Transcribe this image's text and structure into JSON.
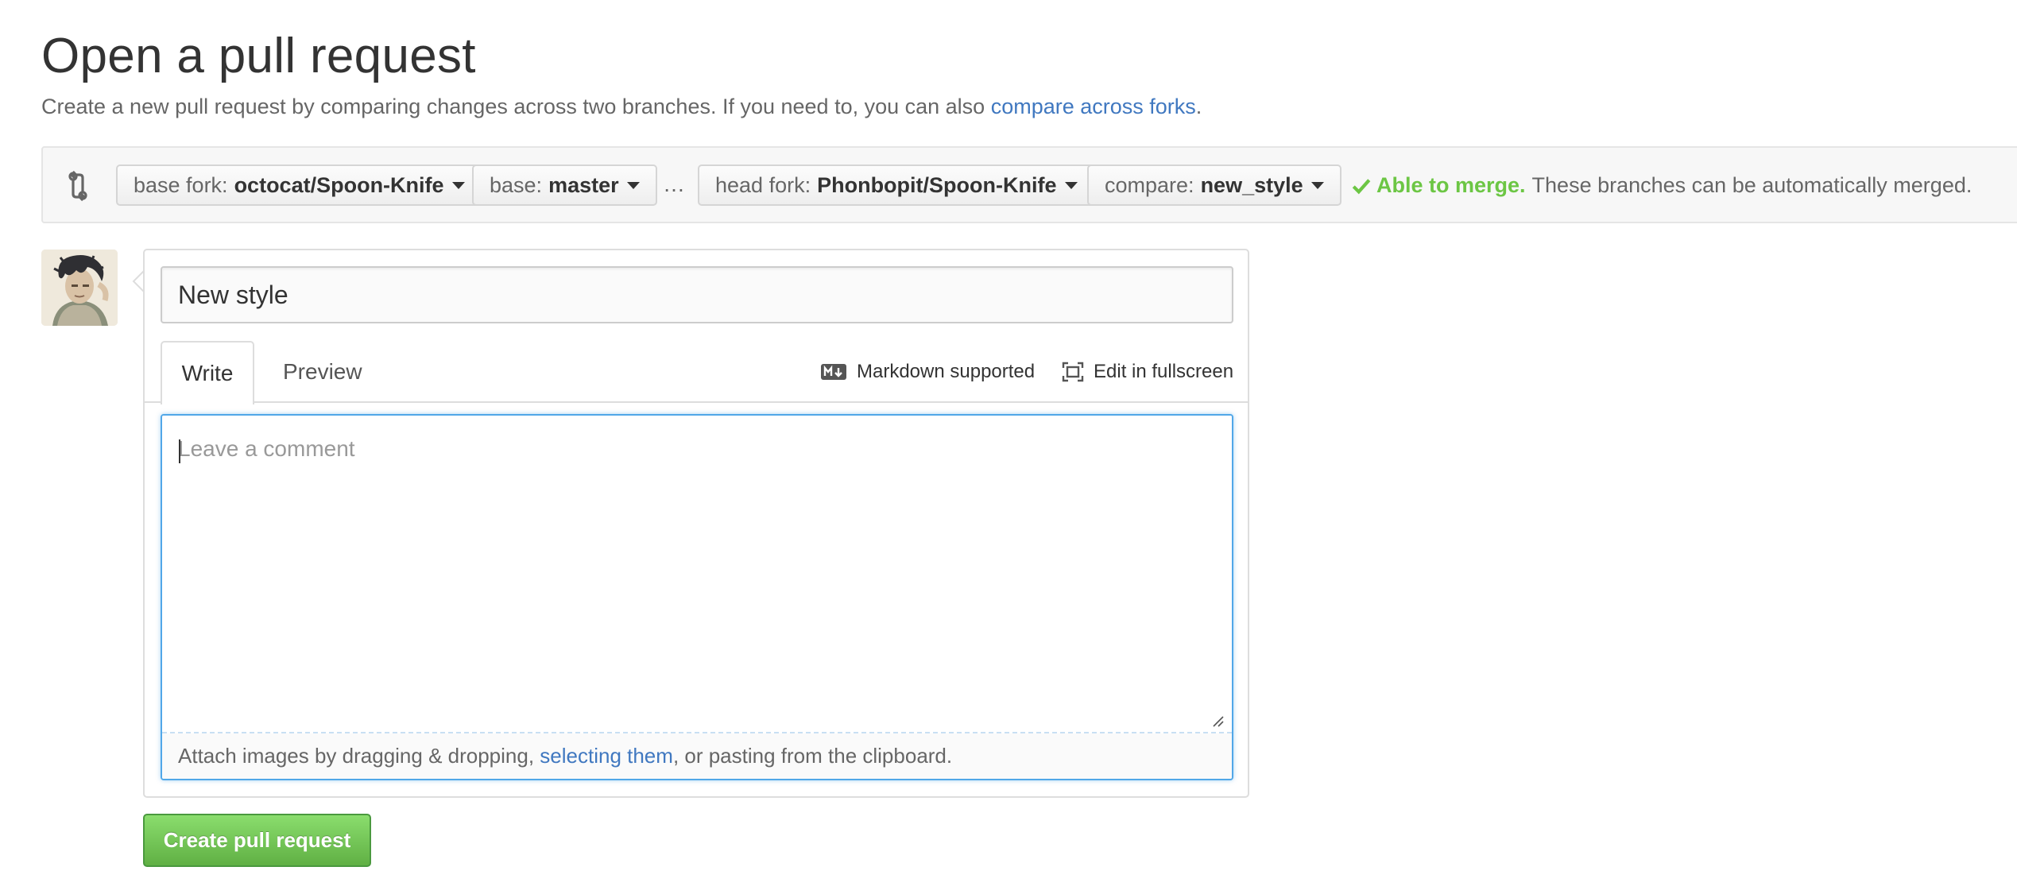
{
  "page": {
    "title": "Open a pull request",
    "description_prefix": "Create a new pull request by comparing changes across two branches. If you need to, you can also ",
    "description_link": "compare across forks",
    "description_suffix": "."
  },
  "range": {
    "base_fork": {
      "label": "base fork:",
      "value": "octocat/Spoon-Knife"
    },
    "base": {
      "label": "base:",
      "value": "master"
    },
    "separator": "…",
    "head_fork": {
      "label": "head fork:",
      "value": "Phonbopit/Spoon-Knife"
    },
    "compare": {
      "label": "compare:",
      "value": "new_style"
    },
    "merge_status": "Able to merge.",
    "merge_message": "These branches can be automatically merged."
  },
  "form": {
    "title_value": "New style",
    "tabs": [
      "Write",
      "Preview"
    ],
    "markdown_label": "Markdown supported",
    "fullscreen_label": "Edit in fullscreen",
    "comment_placeholder": "Leave a comment",
    "attach_prefix": "Attach images by dragging & dropping, ",
    "attach_link": "selecting them",
    "attach_suffix": ", or pasting from the clipboard.",
    "submit_label": "Create pull request"
  },
  "colors": {
    "link": "#4078c0",
    "merge_ok": "#6cc644",
    "focus_border": "#51a7e8",
    "button_green": "#60b044"
  },
  "icons": [
    "git-compare-icon",
    "caret-down-icon",
    "check-icon",
    "markdown-icon",
    "fullscreen-icon",
    "resize-grip-icon"
  ]
}
